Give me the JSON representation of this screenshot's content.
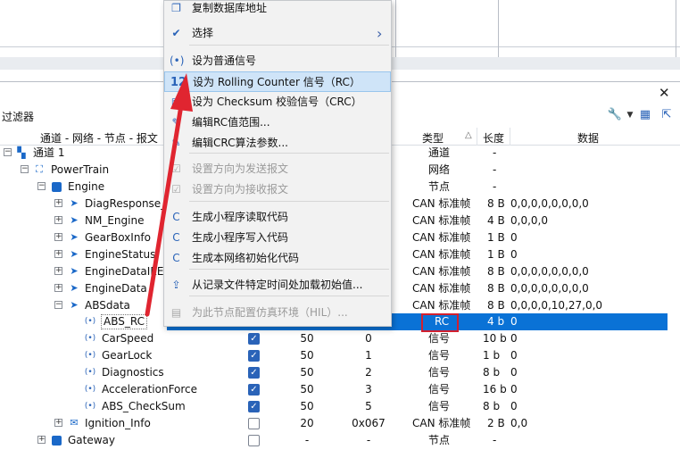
{
  "panel": {
    "filter_label": "过滤器",
    "close_glyph": "✕"
  },
  "columns": {
    "path": "通道 - 网络 - 节点 - 报文",
    "type": "类型",
    "length": "长度",
    "data": "数据",
    "sort_glyph": "△"
  },
  "tree": {
    "channel": {
      "label": "通道 1",
      "type": "通道",
      "len": "-"
    },
    "powertrain": {
      "label": "PowerTrain",
      "type": "网络",
      "len": "-"
    },
    "engine": {
      "label": "Engine",
      "type": "节点",
      "len": "-"
    },
    "messages": [
      {
        "label": "DiagResponse_M",
        "type": "CAN 标准帧",
        "len": "8 B",
        "data": "0,0,0,0,0,0,0,0"
      },
      {
        "label": "NM_Engine",
        "type": "CAN 标准帧",
        "len": "4 B",
        "data": "0,0,0,0"
      },
      {
        "label": "GearBoxInfo",
        "type": "CAN 标准帧",
        "len": "1 B",
        "data": "0"
      },
      {
        "label": "EngineStatus",
        "type": "CAN 标准帧",
        "len": "1 B",
        "data": "0"
      },
      {
        "label": "EngineDataIEEE",
        "type": "CAN 标准帧",
        "len": "8 B",
        "data": "0,0,0,0,0,0,0,0"
      },
      {
        "label": "EngineData",
        "type": "CAN 标准帧",
        "len": "8 B",
        "data": "0,0,0,0,0,0,0,0"
      },
      {
        "label": "ABSdata",
        "type": "CAN 标准帧",
        "len": "8 B",
        "data": "0,0,0,0,10,27,0,0"
      }
    ],
    "signals": [
      {
        "label": "ABS_RC",
        "type": "RC",
        "len": "4 b",
        "data": "0"
      },
      {
        "label": "CarSpeed",
        "cycle": "50",
        "id": "0",
        "type": "信号",
        "len": "10 b",
        "data": "0"
      },
      {
        "label": "GearLock",
        "cycle": "50",
        "id": "1",
        "type": "信号",
        "len": "1 b",
        "data": "0"
      },
      {
        "label": "Diagnostics",
        "cycle": "50",
        "id": "2",
        "type": "信号",
        "len": "8 b",
        "data": "0"
      },
      {
        "label": "AccelerationForce",
        "cycle": "50",
        "id": "3",
        "type": "信号",
        "len": "16 b",
        "data": "0"
      },
      {
        "label": "ABS_CheckSum",
        "cycle": "50",
        "id": "5",
        "type": "信号",
        "len": "8 b",
        "data": "0"
      }
    ],
    "ignition": {
      "label": "Ignition_Info",
      "cycle": "20",
      "id": "0x067",
      "type": "CAN 标准帧",
      "len": "2 B",
      "data": "0,0"
    },
    "gateway": {
      "label": "Gateway",
      "cycle": "-",
      "id": "-",
      "type": "节点",
      "len": "-"
    }
  },
  "menu": {
    "items": [
      {
        "label": "复制数据库地址",
        "icon": "copy-icon",
        "glyph": "❐"
      },
      {
        "label": "选择",
        "icon": "checkbox-icon",
        "glyph": "✔",
        "submenu": "›"
      },
      {
        "label": "设为普通信号",
        "icon": "signal-icon",
        "glyph": "(•)"
      },
      {
        "label": "设为 Rolling Counter 信号（RC）",
        "icon": "counter-icon",
        "glyph": "12"
      },
      {
        "label": "设为 Checksum 校验信号（CRC）",
        "icon": "checksum-icon",
        "glyph": "▣"
      },
      {
        "label": "编辑RC值范围...",
        "icon": "edit-icon",
        "glyph": "✎"
      },
      {
        "label": "编辑CRC算法参数...",
        "icon": "edit-icon",
        "glyph": "✎"
      },
      {
        "label": "设置方向为发送报文",
        "icon": "direction-icon",
        "glyph": "☑"
      },
      {
        "label": "设置方向为接收报文",
        "icon": "direction-icon",
        "glyph": "☑"
      },
      {
        "label": "生成小程序读取代码",
        "icon": "code-icon",
        "glyph": "C"
      },
      {
        "label": "生成小程序写入代码",
        "icon": "code-icon",
        "glyph": "C"
      },
      {
        "label": "生成本网络初始化代码",
        "icon": "code-icon",
        "glyph": "C"
      },
      {
        "label": "从记录文件特定时间处加载初始值...",
        "icon": "load-icon",
        "glyph": "⇪"
      },
      {
        "label": "为此节点配置仿真环境（HIL）...",
        "icon": "hil-icon",
        "glyph": "▤"
      }
    ]
  },
  "colors": {
    "selection": "#0a72d6",
    "accent": "#2a63b8",
    "highlight_box": "#d2202f",
    "arrow": "#e02530"
  }
}
